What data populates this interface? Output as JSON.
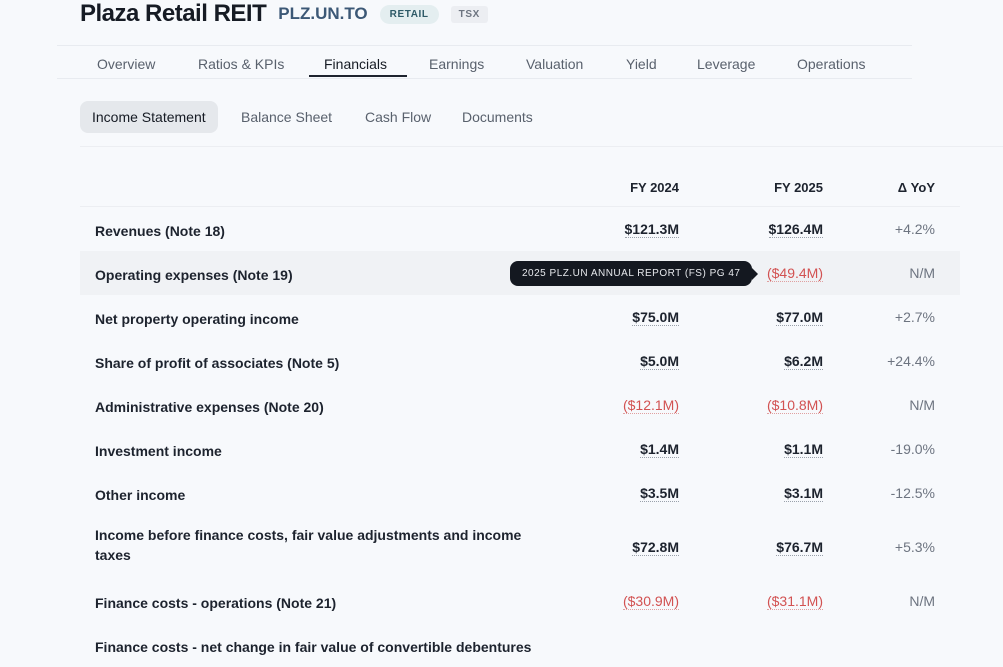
{
  "header": {
    "company": "Plaza Retail REIT",
    "ticker": "PLZ.UN.TO",
    "sector_badge": "RETAIL",
    "exchange_badge": "TSX"
  },
  "top_tabs": [
    "Overview",
    "Ratios & KPIs",
    "Financials",
    "Earnings",
    "Valuation",
    "Yield",
    "Leverage",
    "Operations"
  ],
  "active_top_tab": "Financials",
  "sub_tabs": [
    "Income Statement",
    "Balance Sheet",
    "Cash Flow",
    "Documents"
  ],
  "active_sub_tab": "Income Statement",
  "table": {
    "columns": [
      "FY 2024",
      "FY 2025",
      "Δ YoY"
    ],
    "rows": [
      {
        "label": "Revenues (Note 18)",
        "fy2024": "$121.3M",
        "fy2025": "$126.4M",
        "yoy": "+4.2%"
      },
      {
        "label": "Operating expenses (Note 19)",
        "fy2024": "",
        "fy2025": "($49.4M)",
        "yoy": "N/M"
      },
      {
        "label": "Net property operating income",
        "fy2024": "$75.0M",
        "fy2025": "$77.0M",
        "yoy": "+2.7%"
      },
      {
        "label": "Share of profit of associates (Note 5)",
        "fy2024": "$5.0M",
        "fy2025": "$6.2M",
        "yoy": "+24.4%"
      },
      {
        "label": "Administrative expenses (Note 20)",
        "fy2024": "($12.1M)",
        "fy2025": "($10.8M)",
        "yoy": "N/M"
      },
      {
        "label": "Investment income",
        "fy2024": "$1.4M",
        "fy2025": "$1.1M",
        "yoy": "-19.0%"
      },
      {
        "label": "Other income",
        "fy2024": "$3.5M",
        "fy2025": "$3.1M",
        "yoy": "-12.5%"
      },
      {
        "label": "Income before finance costs, fair value adjustments and income taxes",
        "fy2024": "$72.8M",
        "fy2025": "$76.7M",
        "yoy": "+5.3%"
      },
      {
        "label": "Finance costs - operations (Note 21)",
        "fy2024": "($30.9M)",
        "fy2025": "($31.1M)",
        "yoy": "N/M"
      },
      {
        "label": "Finance costs - net change in fair value of convertible debentures",
        "fy2024": "",
        "fy2025": "",
        "yoy": ""
      }
    ]
  },
  "tooltip": "2025 PLZ.UN ANNUAL REPORT (FS) PG 47",
  "colors": {
    "negative": "#d25252",
    "text": "#1d232e",
    "muted": "#6d7480"
  }
}
